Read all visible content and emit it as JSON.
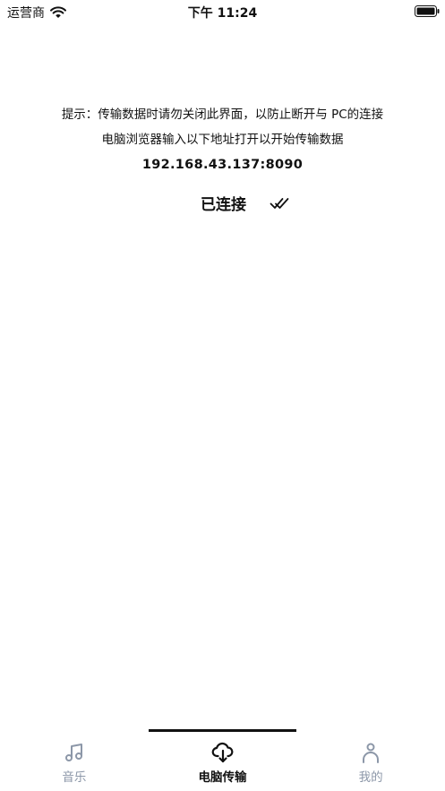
{
  "status_bar": {
    "carrier": "运营商",
    "time": "下午 11:24"
  },
  "content": {
    "hint": "提示：传输数据时请勿关闭此界面，以防止断开与 PC的连接",
    "instruction": "电脑浏览器输入以下地址打开以开始传输数据",
    "address": "192.168.43.137:8090",
    "connection_status": "已连接"
  },
  "tab_bar": {
    "tabs": [
      {
        "label": "音乐",
        "icon": "music-note-icon",
        "active": false
      },
      {
        "label": "电脑传输",
        "icon": "cloud-download-icon",
        "active": true
      },
      {
        "label": "我的",
        "icon": "person-icon",
        "active": false
      }
    ]
  },
  "colors": {
    "text": "#111111",
    "inactive_tab": "#8c97a8",
    "background": "#ffffff"
  }
}
